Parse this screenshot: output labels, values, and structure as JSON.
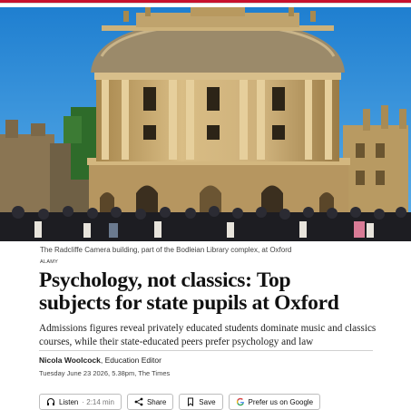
{
  "photo": {
    "caption": "The Radcliffe Camera building, part of the Bodleian Library complex, at Oxford",
    "credit": "ALAMY"
  },
  "article": {
    "headline_line1": "Psychology, not classics: Top",
    "headline_line2": "subjects for state pupils at Oxford",
    "standfirst_line1": "Admissions figures reveal privately educated students dominate music and classics",
    "standfirst_line2": "courses, while their state-educated peers prefer psychology and law",
    "author": "Nicola Woolcock",
    "role": ", Education Editor",
    "dateline": "Tuesday June 23 2026, 5.38pm, The Times"
  },
  "actions": {
    "listen_label": "Listen",
    "listen_duration": "· 2:14 min",
    "share_label": "Share",
    "save_label": "Save",
    "google_label": "Prefer us on Google"
  },
  "icons": {
    "listen": "headphones-icon",
    "share": "share-icon",
    "save": "bookmark-icon",
    "google": "google-g-icon"
  },
  "colors": {
    "brand_bar": "#c8102e",
    "sky": "#2f8fd8",
    "stone": "#c9a86a"
  }
}
